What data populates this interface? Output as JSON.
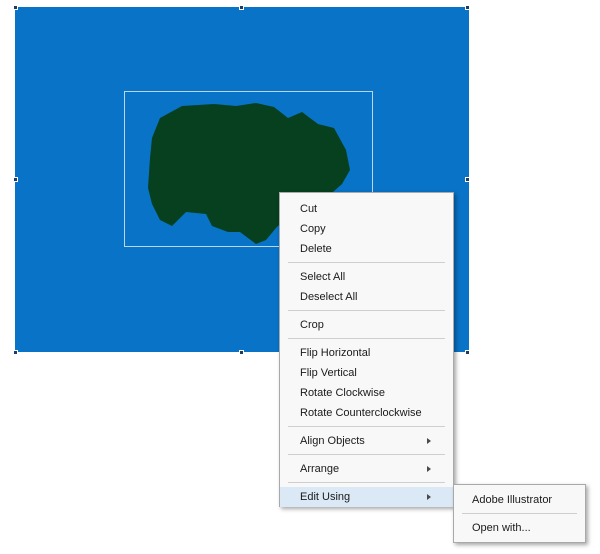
{
  "colors": {
    "canvas_fill": "#0873c7",
    "blob_fill": "#06401e",
    "menu_background": "#f8f8f8",
    "menu_highlight": "#dbe8f6",
    "handle": "#1c3c6c"
  },
  "context_menu": {
    "cut": "Cut",
    "copy": "Copy",
    "delete": "Delete",
    "select_all": "Select All",
    "deselect_all": "Deselect All",
    "crop": "Crop",
    "flip_horizontal": "Flip Horizontal",
    "flip_vertical": "Flip Vertical",
    "rotate_clockwise": "Rotate Clockwise",
    "rotate_counterclockwise": "Rotate Counterclockwise",
    "align_objects": "Align Objects",
    "arrange": "Arrange",
    "edit_using": "Edit Using"
  },
  "submenu": {
    "adobe_illustrator": "Adobe Illustrator",
    "open_with": "Open with..."
  },
  "icons": {
    "submenu_arrow": "chevron-right-icon"
  }
}
